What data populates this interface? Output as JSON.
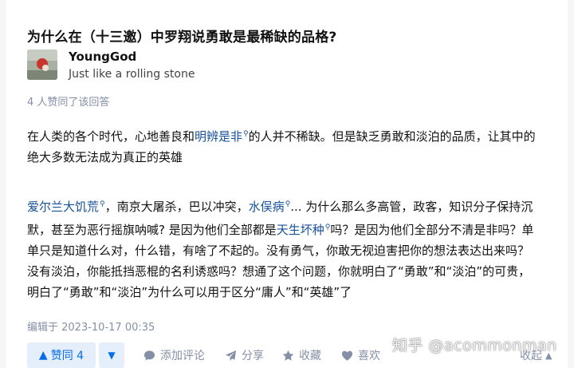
{
  "question": {
    "title": "为什么在（十三邀）中罗翔说勇敢是最稀缺的品格?"
  },
  "author": {
    "name": "YoungGod",
    "bio": "Just like a rolling stone"
  },
  "upvoters_text": "4 人赞同了该回答",
  "paragraph1": {
    "t1": "在人类的各个时代，心地善良和",
    "kw1": "明辨是非",
    "t2": "的人并不稀缺。但是缺乏勇敢和淡泊的品质，让其中的绝大多数无法成为真正的英雄"
  },
  "paragraph2": {
    "kw1": "爱尔兰大饥荒",
    "t1": "，南京大屠杀，巴以冲突，",
    "kw2": "水俣病",
    "t2": "... 为什么那么多高管，政客，知识分子保持沉默，甚至为恶行摇旗呐喊? 是因为他们全部都是",
    "kw3": "天生坏种",
    "t3": "吗？是因为他们全部分不清是非吗？单单只是知道什么对，什么错，有啥了不起的。没有勇气，你敢无视迫害把你的想法表达出来吗？没有淡泊，你能抵挡恶棍的名利诱惑吗？想通了这个问题，你就明白了“勇敢”和“淡泊”的可贵，明白了“勇敢”和“淡泊”为什么可以用于区分“庸人”和“英雄”了"
  },
  "edited_text": "编辑于 2023-10-17 00:35",
  "actions": {
    "upvote_label": "赞同 4",
    "comment_label": "添加评论",
    "share_label": "分享",
    "favorite_label": "收藏",
    "like_label": "喜欢",
    "collapse_label": "收起"
  },
  "watermark": "知乎 @acommonman",
  "icons": {
    "upvote": "triangle-up-icon",
    "downvote": "triangle-down-icon",
    "comment": "comment-bubble-icon",
    "share": "paper-plane-icon",
    "favorite": "star-icon",
    "like": "heart-icon",
    "keyword": "search-icon",
    "collapse": "chevron-up-icon"
  },
  "colors": {
    "link": "#175199",
    "accent": "#056de8",
    "muted": "#8590a6"
  }
}
